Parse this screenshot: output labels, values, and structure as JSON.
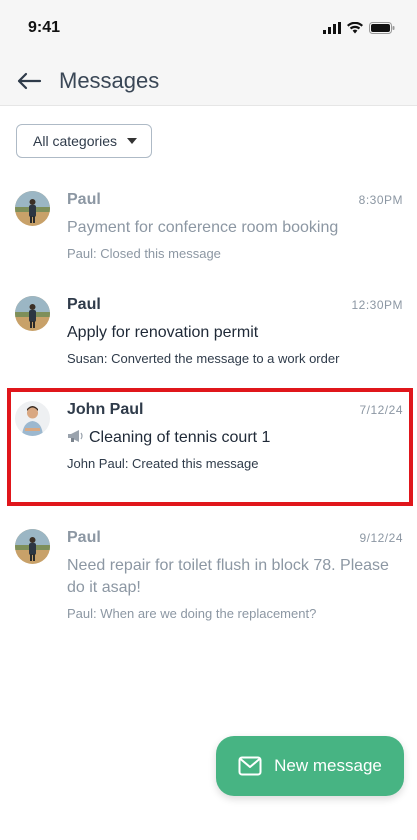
{
  "status": {
    "time": "9:41"
  },
  "header": {
    "title": "Messages"
  },
  "filter": {
    "selected": "All categories"
  },
  "messages": [
    {
      "sender": "Paul",
      "time": "8:30PM",
      "subject": "Payment for conference room booking",
      "activity": "Paul: Closed this message",
      "state": "read"
    },
    {
      "sender": "Paul",
      "time": "12:30PM",
      "subject": "Apply for renovation permit",
      "activity": "Susan: Converted the message to a work order",
      "state": "unread"
    },
    {
      "sender": "John Paul",
      "time": "7/12/24",
      "subject": "Cleaning of tennis court 1",
      "activity": "John Paul: Created this message",
      "state": "unread",
      "icon": "megaphone-icon"
    },
    {
      "sender": "Paul",
      "time": "9/12/24",
      "subject": "Need repair for toilet flush in block 78. Please do it asap!",
      "activity": "Paul: When are we doing the replacement?",
      "state": "read"
    }
  ],
  "fab": {
    "label": "New message"
  },
  "colors": {
    "accent": "#47b483",
    "highlight": "#e0161b"
  }
}
